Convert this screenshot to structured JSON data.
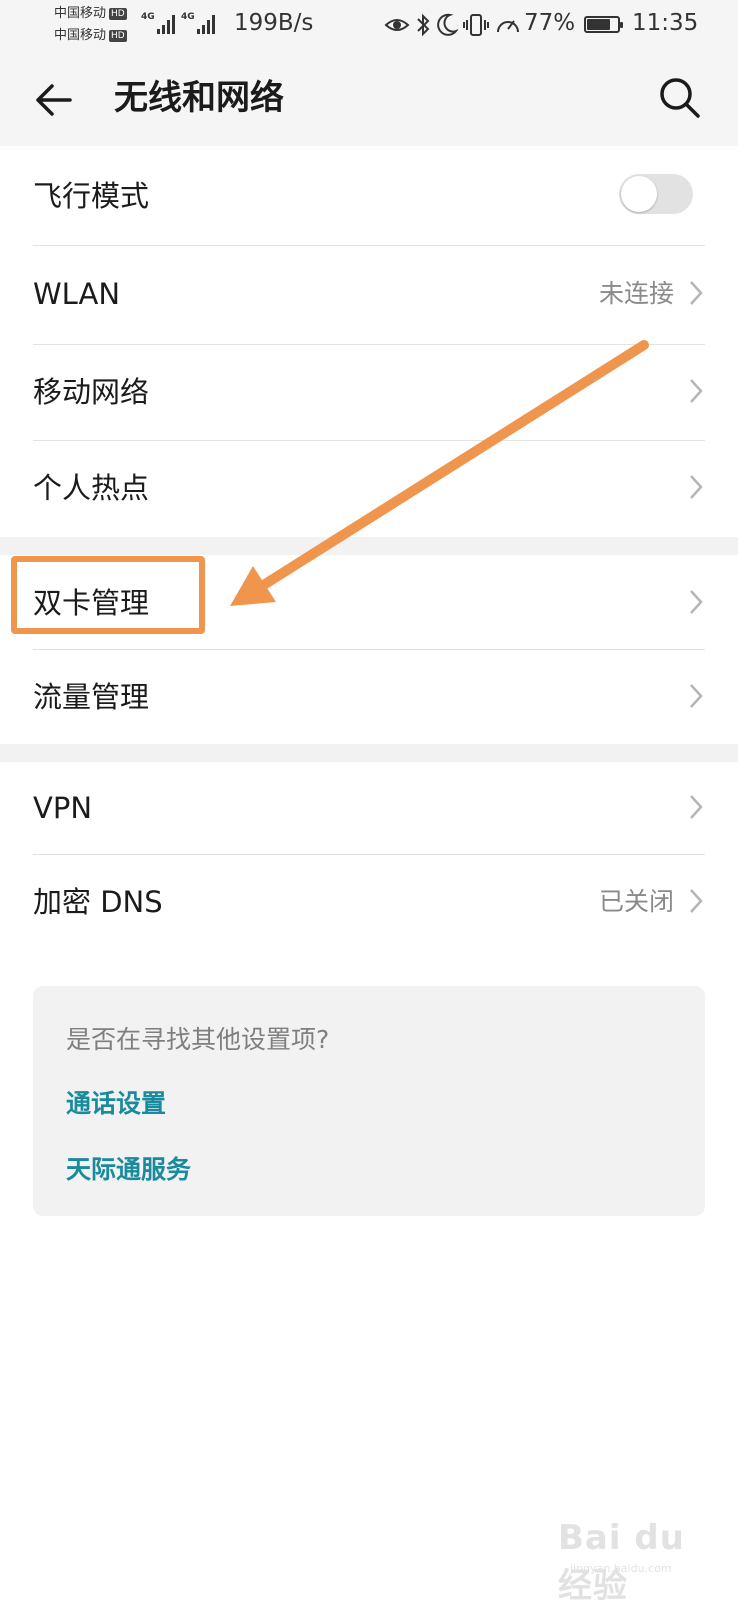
{
  "status_bar": {
    "carrier1": "中国移动",
    "carrier2": "中国移动",
    "hd_badge": "HD",
    "network_type": "4G",
    "net_speed": "199B/s",
    "battery_percent": "77%",
    "battery_level": 0.77,
    "time": "11:35",
    "icons": [
      "eye-comfort-icon",
      "bluetooth-icon",
      "do-not-disturb-moon-icon",
      "vibrate-icon",
      "speed-gauge-icon",
      "battery-charging-icon"
    ]
  },
  "header": {
    "title": "无线和网络",
    "back_icon": "arrow-left-icon",
    "search_icon": "search-icon"
  },
  "group1": [
    {
      "label": "飞行模式",
      "type": "toggle",
      "on": false
    },
    {
      "label": "WLAN",
      "value": "未连接"
    },
    {
      "label": "移动网络"
    },
    {
      "label": "个人热点"
    }
  ],
  "group2": [
    {
      "label": "双卡管理"
    },
    {
      "label": "流量管理"
    }
  ],
  "group3": [
    {
      "label": "VPN"
    },
    {
      "label": "加密 DNS",
      "value": "已关闭"
    }
  ],
  "suggestions": {
    "question": "是否在寻找其他设置项?",
    "links": [
      "通话设置",
      "天际通服务"
    ]
  },
  "annotation": {
    "highlight_color": "#f0954e"
  },
  "watermark": {
    "text": "Bai du 经验",
    "sub": "jingyan.baidu.com"
  }
}
